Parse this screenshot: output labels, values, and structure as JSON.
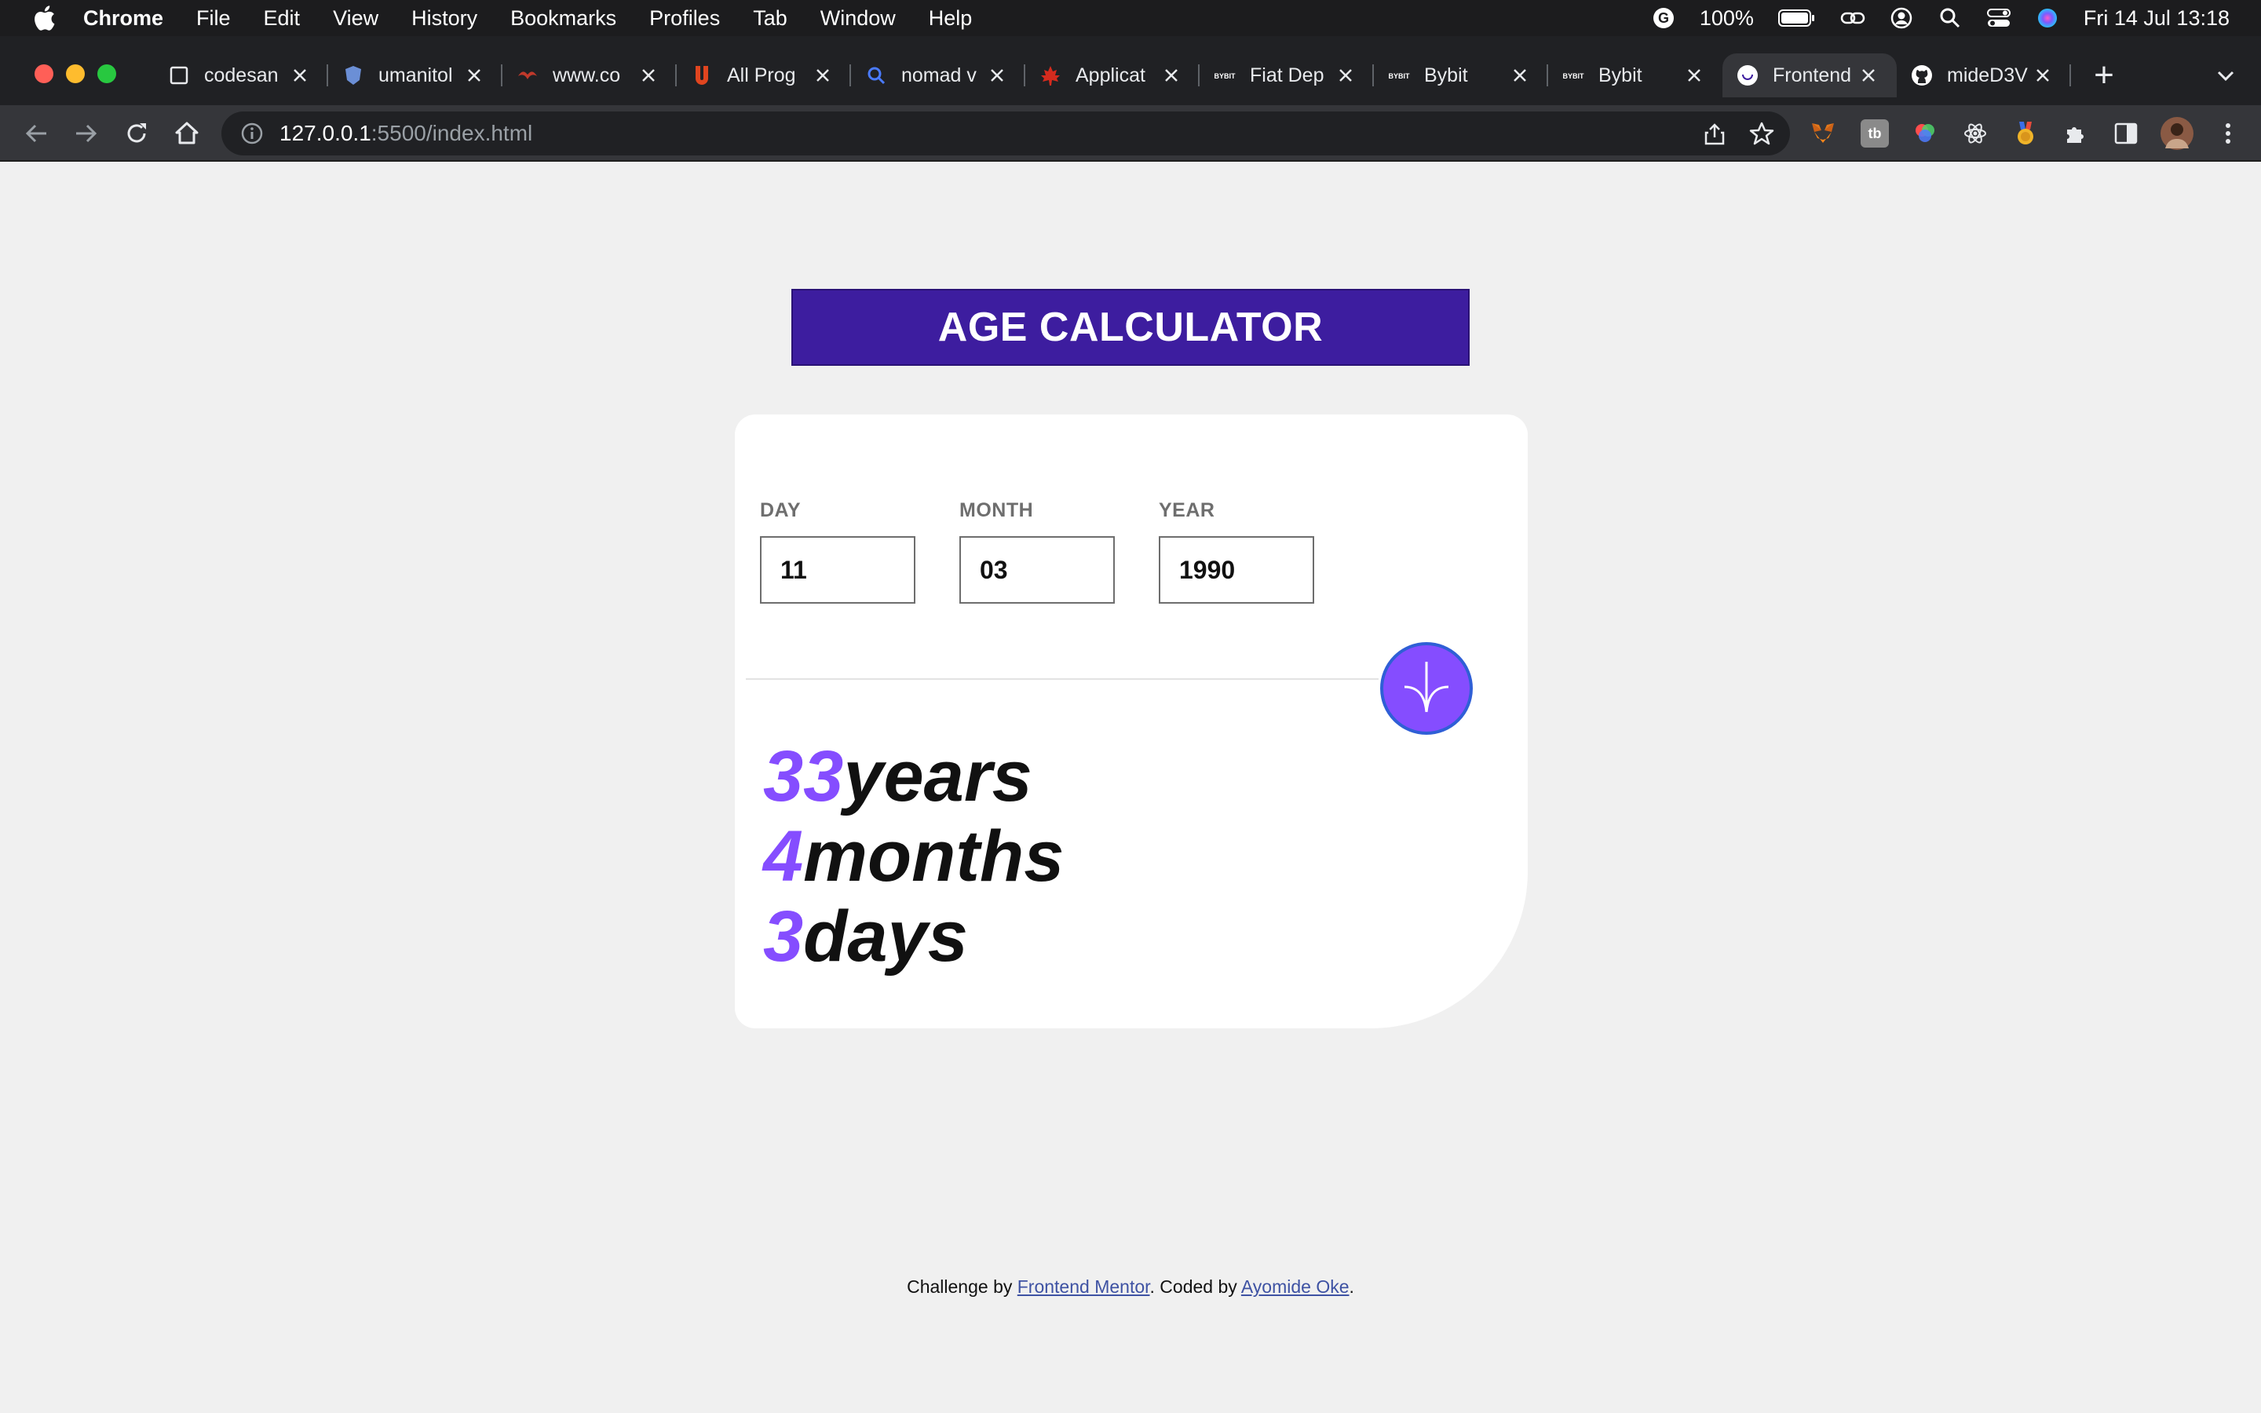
{
  "menubar": {
    "app_name": "Chrome",
    "items": [
      "File",
      "Edit",
      "View",
      "History",
      "Bookmarks",
      "Profiles",
      "Tab",
      "Window",
      "Help"
    ],
    "battery": "100%",
    "clock": "Fri 14 Jul  13:18"
  },
  "tabs": [
    {
      "title": "codesan",
      "icon": "square-icon",
      "color": "#e8eaed"
    },
    {
      "title": "umanitol",
      "icon": "shield-crest-icon",
      "color": "#6b8fd6"
    },
    {
      "title": "www.co",
      "icon": "bird-icon",
      "color": "#c0392b"
    },
    {
      "title": "All Prog",
      "icon": "u-logo-icon",
      "color": "#e0451f"
    },
    {
      "title": "nomad v",
      "icon": "search-icon",
      "color": "#4a7bff"
    },
    {
      "title": "Applicat",
      "icon": "maple-leaf-icon",
      "color": "#d52b1e"
    },
    {
      "title": "Fiat Dep",
      "icon": "bybit-icon",
      "color": "#ffffff"
    },
    {
      "title": "Bybit",
      "icon": "bybit-icon",
      "color": "#ffffff"
    },
    {
      "title": "Bybit",
      "icon": "bybit-icon",
      "color": "#ffffff"
    },
    {
      "title": "Frontend",
      "icon": "frontend-mentor-icon",
      "color": "#ffffff",
      "active": true
    },
    {
      "title": "mideD3V",
      "icon": "github-icon",
      "color": "#ffffff"
    }
  ],
  "toolbar": {
    "url_host": "127.0.0.1",
    "url_rest": ":5500/index.html"
  },
  "app": {
    "title": "AGE CALCULATOR",
    "fields": [
      {
        "label": "DAY",
        "value": "11"
      },
      {
        "label": "MONTH",
        "value": "03"
      },
      {
        "label": "YEAR",
        "value": "1990"
      }
    ],
    "results": [
      {
        "value": "33",
        "unit": "years"
      },
      {
        "value": "4",
        "unit": "months"
      },
      {
        "value": "3",
        "unit": "days"
      }
    ],
    "accent_color": "#854dff",
    "banner_color": "#3d1d9f"
  },
  "footer": {
    "prefix": "Challenge by ",
    "link1": "Frontend Mentor",
    "middle": ". Coded by ",
    "link2": "Ayomide Oke",
    "suffix": "."
  }
}
